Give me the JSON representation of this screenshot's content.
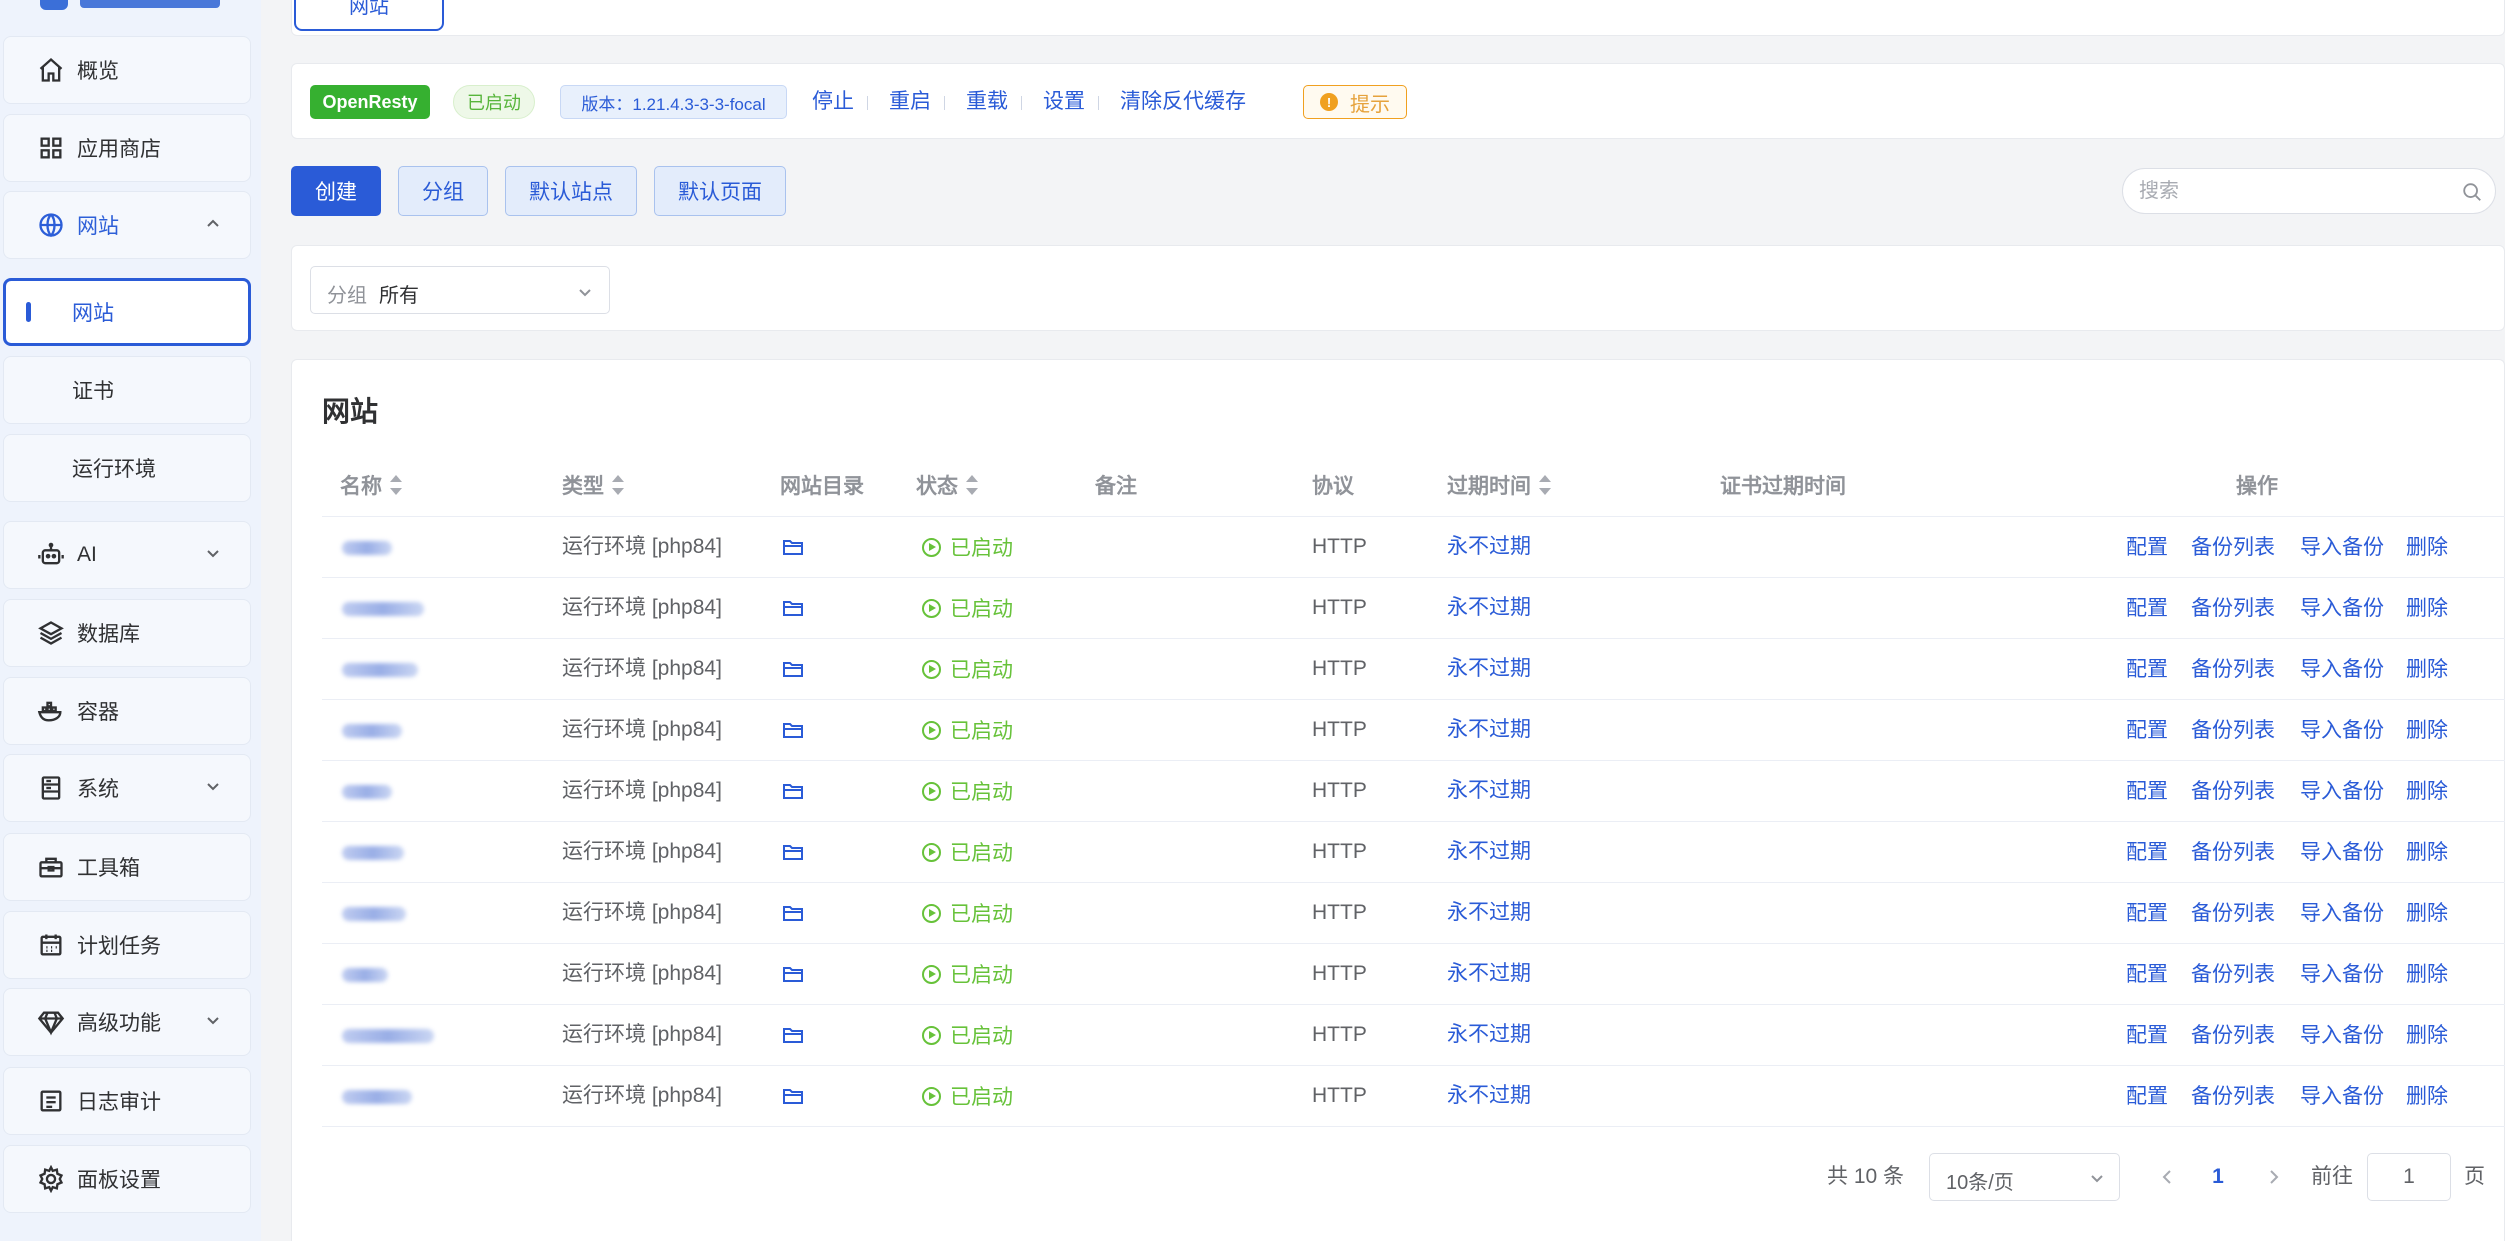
{
  "sidebar": {
    "items": [
      {
        "label": "概览",
        "icon": "home-icon"
      },
      {
        "label": "应用商店",
        "icon": "grid-icon"
      },
      {
        "label": "网站",
        "icon": "globe-icon",
        "expanded": true
      },
      {
        "label": "AI",
        "icon": "robot-icon"
      },
      {
        "label": "数据库",
        "icon": "layers-icon"
      },
      {
        "label": "容器",
        "icon": "docker-icon"
      },
      {
        "label": "系统",
        "icon": "server-icon"
      },
      {
        "label": "工具箱",
        "icon": "toolbox-icon"
      },
      {
        "label": "计划任务",
        "icon": "calendar-icon"
      },
      {
        "label": "高级功能",
        "icon": "diamond-icon"
      },
      {
        "label": "日志审计",
        "icon": "log-icon"
      },
      {
        "label": "面板设置",
        "icon": "gear-icon"
      }
    ],
    "website_sub": [
      {
        "label": "网站",
        "active": true
      },
      {
        "label": "证书"
      },
      {
        "label": "运行环境"
      }
    ]
  },
  "top_tab": {
    "label": "网站"
  },
  "status_bar": {
    "app": "OpenResty",
    "state": "已启动",
    "version": "版本：1.21.4.3-3-3-focal",
    "actions": [
      "停止",
      "重启",
      "重载",
      "设置",
      "清除反代缓存"
    ],
    "tip": "提示",
    "tip_mark": "!"
  },
  "toolbar": {
    "create": "创建",
    "group": "分组",
    "default_site": "默认站点",
    "default_page": "默认页面",
    "search_placeholder": "搜索"
  },
  "filter": {
    "prefix": "分组",
    "value": "所有"
  },
  "table": {
    "title": "网站",
    "columns": {
      "name": "名称",
      "type": "类型",
      "dir": "网站目录",
      "status": "状态",
      "remark": "备注",
      "protocol": "协议",
      "expire": "过期时间",
      "cert_expire": "证书过期时间",
      "ops": "操作"
    },
    "rows": [
      {
        "type": "运行环境 [php84]",
        "status": "已启动",
        "protocol": "HTTP",
        "expire": "永不过期"
      },
      {
        "type": "运行环境 [php84]",
        "status": "已启动",
        "protocol": "HTTP",
        "expire": "永不过期"
      },
      {
        "type": "运行环境 [php84]",
        "status": "已启动",
        "protocol": "HTTP",
        "expire": "永不过期"
      },
      {
        "type": "运行环境 [php84]",
        "status": "已启动",
        "protocol": "HTTP",
        "expire": "永不过期"
      },
      {
        "type": "运行环境 [php84]",
        "status": "已启动",
        "protocol": "HTTP",
        "expire": "永不过期"
      },
      {
        "type": "运行环境 [php84]",
        "status": "已启动",
        "protocol": "HTTP",
        "expire": "永不过期"
      },
      {
        "type": "运行环境 [php84]",
        "status": "已启动",
        "protocol": "HTTP",
        "expire": "永不过期"
      },
      {
        "type": "运行环境 [php84]",
        "status": "已启动",
        "protocol": "HTTP",
        "expire": "永不过期"
      },
      {
        "type": "运行环境 [php84]",
        "status": "已启动",
        "protocol": "HTTP",
        "expire": "永不过期"
      },
      {
        "type": "运行环境 [php84]",
        "status": "已启动",
        "protocol": "HTTP",
        "expire": "永不过期"
      }
    ],
    "row_actions": [
      "配置",
      "备份列表",
      "导入备份",
      "删除"
    ]
  },
  "pagination": {
    "total": "共 10 条",
    "page_size": "10条/页",
    "current": "1",
    "goto_label": "前往",
    "goto_value": "1",
    "page_suffix": "页"
  },
  "colors": {
    "accent": "#2a5bd7",
    "success": "#67c23a",
    "warning": "#e6a23c",
    "openresty_tag": "#36b030"
  }
}
